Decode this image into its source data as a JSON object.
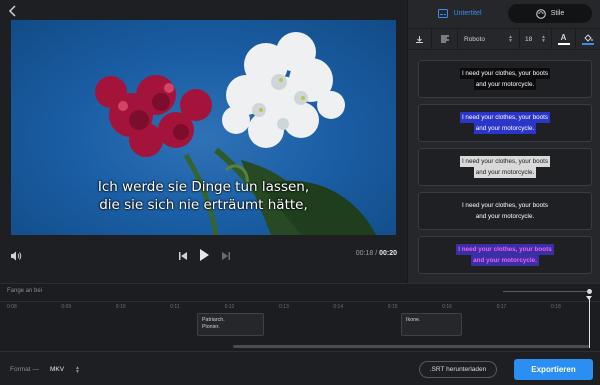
{
  "player": {
    "subtitle_line1": "Ich werde sie Dinge tun lassen,",
    "subtitle_line2": "die sie sich nie erträumt hätte,",
    "current_time": "00:18",
    "time_separator": "/",
    "total_time": "00:20"
  },
  "panel": {
    "tab_subtitle": "Untertitel",
    "tab_styles": "Stile",
    "font_name": "Roboto",
    "font_size": "18",
    "color_letter": "A",
    "style_line1": "I need your clothes, your boots",
    "style_line2": "and your motorcycle.",
    "style_presets": [
      {
        "text_color": "#ffffff",
        "bg": "#0b0b0d"
      },
      {
        "text_color": "#ffffff",
        "bg": "#2b36c9"
      },
      {
        "text_color": "#1a1a1a",
        "bg": "#d9d9d9"
      },
      {
        "text_color": "#ffffff",
        "bg": "transparent"
      },
      {
        "text_color": "#f05ff0",
        "bg": "#3b2fa6"
      }
    ]
  },
  "timeline": {
    "label": "Fange an bei",
    "ticks": [
      "0:08",
      "0:09",
      "0:10",
      "0:11",
      "0:12",
      "0:13",
      "0:14",
      "0:15",
      "0:16",
      "0:17",
      "0:18",
      "0:19"
    ],
    "cues": [
      {
        "line1": "Patriarch.",
        "line2": "Pionier."
      },
      {
        "line1": "Ikone.",
        "line2": ""
      }
    ]
  },
  "footer": {
    "format_label": "Format —",
    "format_value": "MKV",
    "srt_button": ".SRT herunterladen",
    "export_button": "Exportieren"
  },
  "colors": {
    "accent": "#2b8ef2",
    "background": "#1e1f22"
  },
  "icons": [
    "back-icon",
    "volume-icon",
    "skip-back-icon",
    "play-icon",
    "skip-forward-icon",
    "subtitle-icon",
    "palette-icon",
    "download-icon",
    "align-icon",
    "fill-icon"
  ]
}
